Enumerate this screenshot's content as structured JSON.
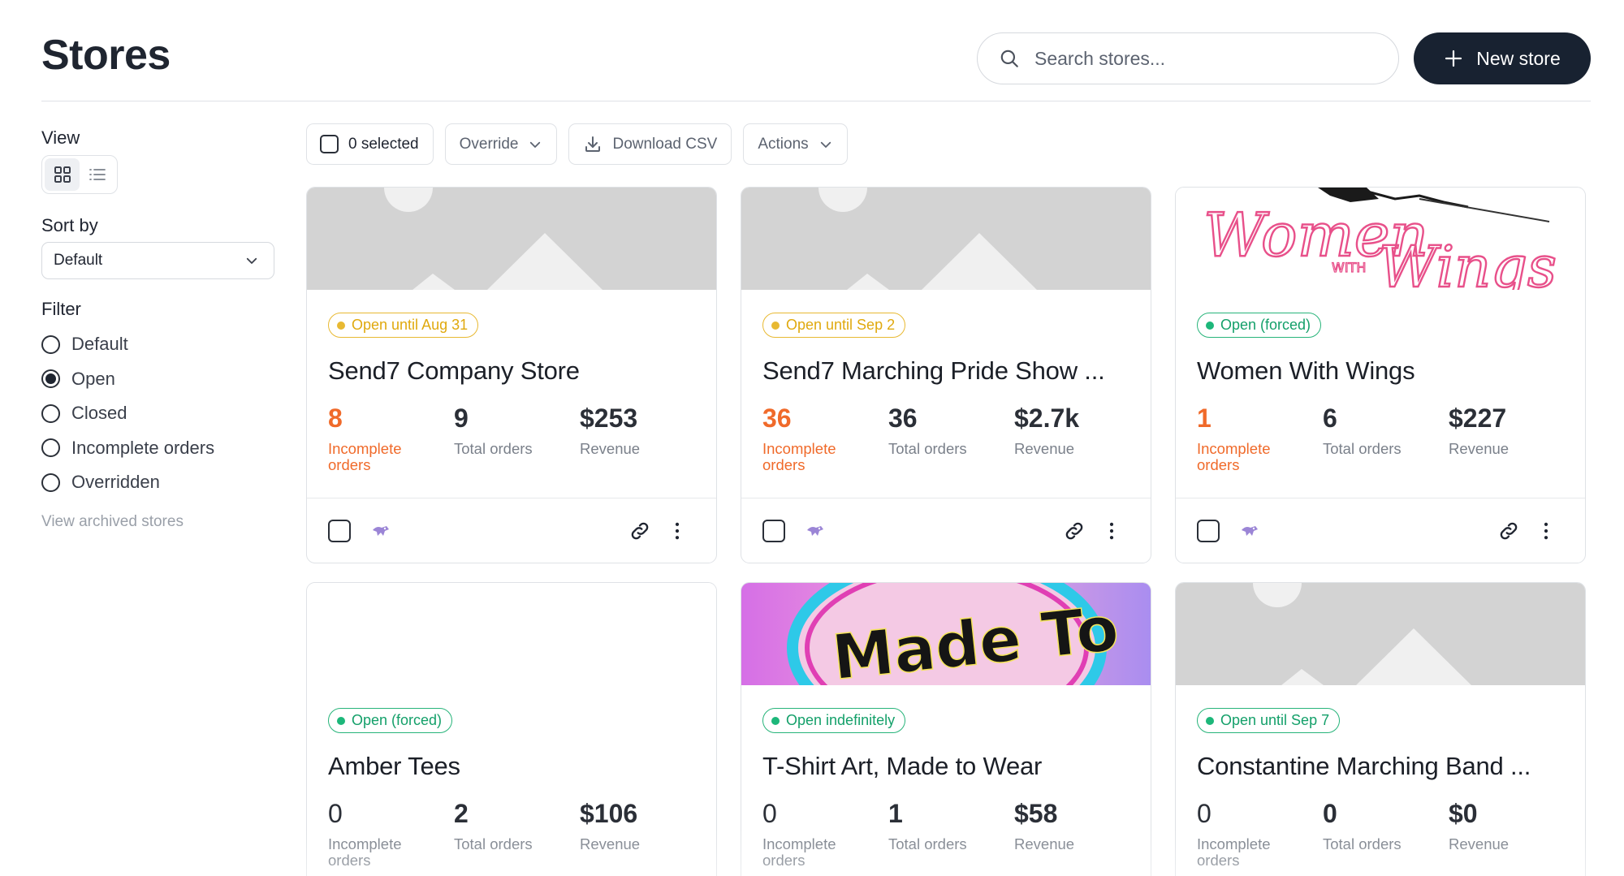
{
  "header": {
    "title": "Stores",
    "search_placeholder": "Search stores...",
    "new_store_label": "New store"
  },
  "sidebar": {
    "view_label": "View",
    "view_modes": [
      "grid",
      "list"
    ],
    "active_view": "grid",
    "sort_label": "Sort by",
    "sort_value": "Default",
    "filter_label": "Filter",
    "filters": [
      {
        "label": "Default",
        "checked": false
      },
      {
        "label": "Open",
        "checked": true
      },
      {
        "label": "Closed",
        "checked": false
      },
      {
        "label": "Incomplete orders",
        "checked": false
      },
      {
        "label": "Overridden",
        "checked": false
      }
    ],
    "view_archived_label": "View archived stores"
  },
  "toolbar": {
    "selected_label": "0 selected",
    "override_label": "Override",
    "download_label": "Download CSV",
    "actions_label": "Actions"
  },
  "stores": [
    {
      "status": "Open until Aug 31",
      "status_color": "orange",
      "banner": "placeholder",
      "name": "Send7 Company Store",
      "incomplete": "8",
      "incomplete_label": "Incomplete orders",
      "incomplete_alert": true,
      "total": "9",
      "total_label": "Total orders",
      "revenue": "$253",
      "revenue_label": "Revenue"
    },
    {
      "status": "Open until Sep 2",
      "status_color": "orange",
      "banner": "placeholder",
      "name": "Send7 Marching Pride Show ...",
      "incomplete": "36",
      "incomplete_label": "Incomplete orders",
      "incomplete_alert": true,
      "total": "36",
      "total_label": "Total orders",
      "revenue": "$2.7k",
      "revenue_label": "Revenue"
    },
    {
      "status": "Open (forced)",
      "status_color": "green",
      "banner": "women-with-wings-logo",
      "banner_text": [
        "Women",
        "WITH",
        "Wings"
      ],
      "name": "Women With Wings",
      "incomplete": "1",
      "incomplete_label": "Incomplete orders",
      "incomplete_alert": true,
      "total": "6",
      "total_label": "Total orders",
      "revenue": "$227",
      "revenue_label": "Revenue"
    },
    {
      "status": "Open (forced)",
      "status_color": "green",
      "banner": "blank",
      "name": "Amber Tees",
      "incomplete": "0",
      "incomplete_label": "Incomplete orders",
      "incomplete_alert": false,
      "total": "2",
      "total_label": "Total orders",
      "revenue": "$106",
      "revenue_label": "Revenue"
    },
    {
      "status": "Open indefinitely",
      "status_color": "green",
      "banner": "made-to-wear-art",
      "banner_text": [
        "Made To"
      ],
      "name": "T-Shirt Art, Made to Wear",
      "incomplete": "0",
      "incomplete_label": "Incomplete orders",
      "incomplete_alert": false,
      "total": "1",
      "total_label": "Total orders",
      "revenue": "$58",
      "revenue_label": "Revenue"
    },
    {
      "status": "Open until Sep 7",
      "status_color": "green",
      "banner": "placeholder",
      "name": "Constantine Marching Band ...",
      "incomplete": "0",
      "incomplete_label": "Incomplete orders",
      "incomplete_alert": false,
      "total": "0",
      "total_label": "Total orders",
      "revenue": "$0",
      "revenue_label": "Revenue"
    }
  ]
}
